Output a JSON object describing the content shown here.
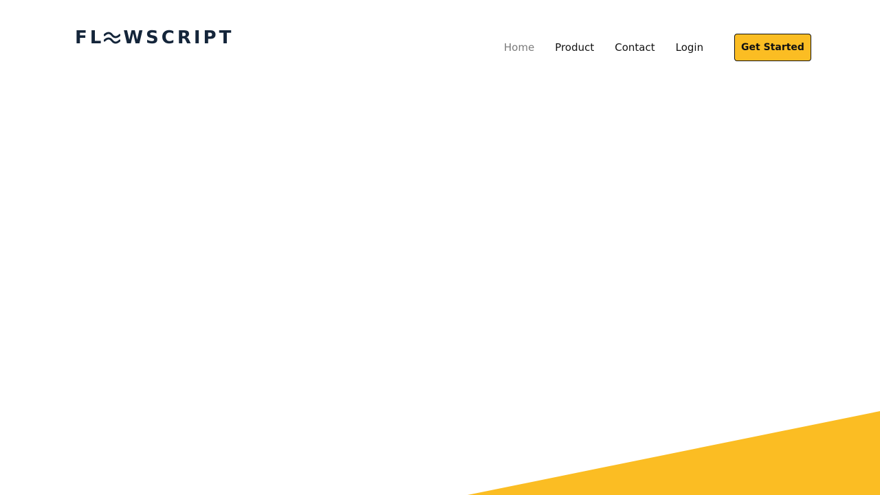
{
  "brand": {
    "logo_left": "FL",
    "logo_right": "WSCRIPT",
    "logo_icon": "wave-icon",
    "color": "#14253a"
  },
  "nav": {
    "items": [
      {
        "label": "Home",
        "active": true
      },
      {
        "label": "Product",
        "active": false
      },
      {
        "label": "Contact",
        "active": false
      },
      {
        "label": "Login",
        "active": false
      }
    ]
  },
  "cta": {
    "label": "Get Started",
    "background": "#fbbd23"
  },
  "accent_color": "#fbbd23"
}
